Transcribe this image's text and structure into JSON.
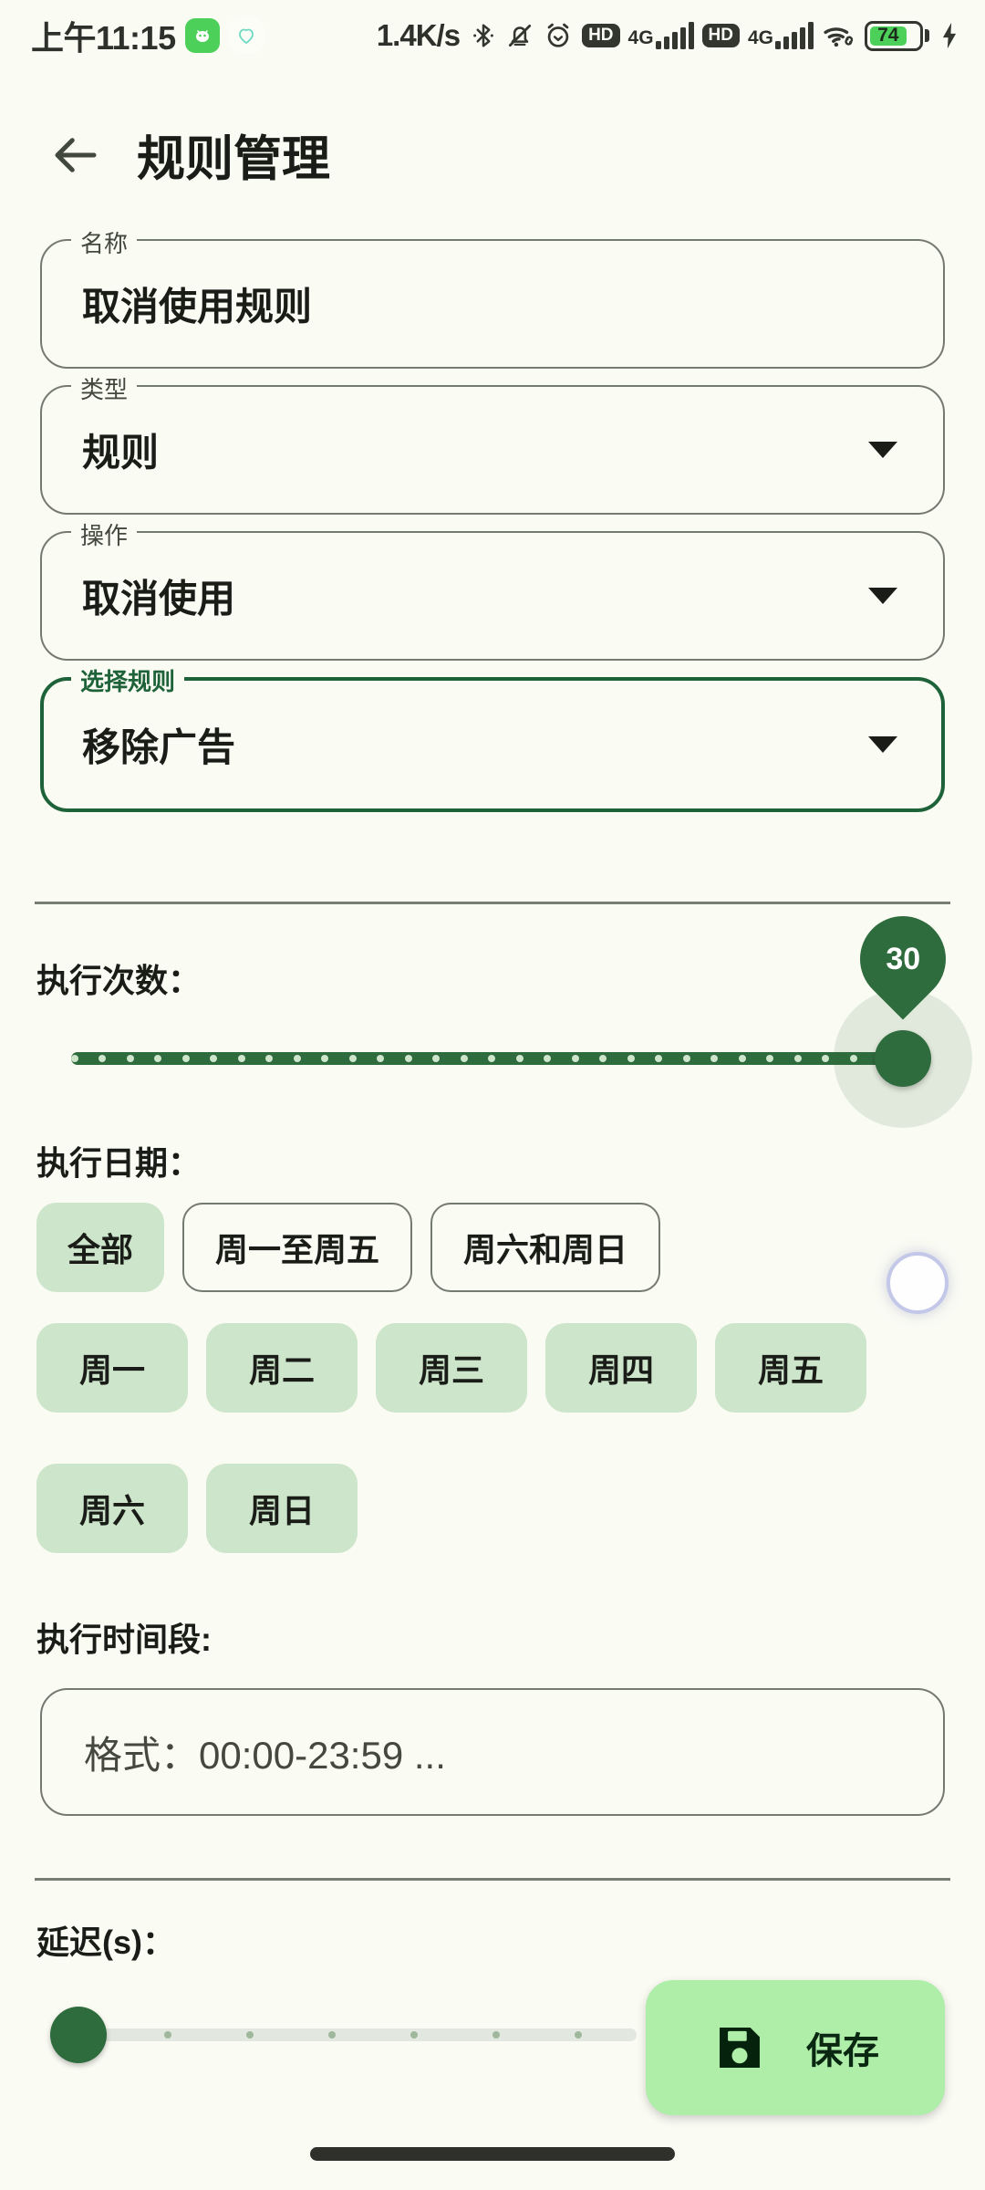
{
  "status_bar": {
    "time": "上午11:15",
    "network_speed": "1.4K/s",
    "icons": [
      "android-app-icon",
      "heart-app-icon",
      "bluetooth-icon",
      "mute-bell-icon",
      "alarm-icon",
      "hd-icon",
      "signal-bars-icon",
      "4g-icon",
      "wifi-icon",
      "battery-icon",
      "charging-bolt-icon"
    ],
    "hd_label": "HD",
    "net_label_1": "4G",
    "net_label_2": "4G",
    "battery_level": "74"
  },
  "app_bar": {
    "back_icon": "arrow-left-icon",
    "title": "规则管理"
  },
  "form": {
    "fields": [
      {
        "legend": "名称",
        "value": "取消使用规则",
        "type": "text",
        "focused": false
      },
      {
        "legend": "类型",
        "value": "规则",
        "type": "select",
        "focused": false
      },
      {
        "legend": "操作",
        "value": "取消使用",
        "type": "select",
        "focused": false
      },
      {
        "legend": "选择规则",
        "value": "移除广告",
        "type": "select",
        "focused": true
      }
    ]
  },
  "execution_count": {
    "label": "执行次数：",
    "value": "30",
    "min": 0,
    "max": 30,
    "percent": 100
  },
  "execution_days": {
    "label": "执行日期：",
    "presets": [
      {
        "label": "全部",
        "selected": true
      },
      {
        "label": "周一至周五",
        "selected": false
      },
      {
        "label": "周六和周日",
        "selected": false
      }
    ],
    "days_row1": [
      {
        "label": "周一",
        "selected": true
      },
      {
        "label": "周二",
        "selected": true
      },
      {
        "label": "周三",
        "selected": true
      },
      {
        "label": "周四",
        "selected": true
      },
      {
        "label": "周五",
        "selected": true
      }
    ],
    "days_row2": [
      {
        "label": "周六",
        "selected": true
      },
      {
        "label": "周日",
        "selected": true
      }
    ]
  },
  "execution_time_range": {
    "label": "执行时间段:",
    "placeholder": "格式：00:00-23:59 ...",
    "value": ""
  },
  "delay": {
    "label": "延迟(s)：",
    "value": "0",
    "min": 0,
    "max": 6,
    "percent": 0
  },
  "save_button": {
    "label": "保存",
    "icon": "save-floppy-icon"
  },
  "floating_ball": {
    "icon": "assistive-touch-ball"
  },
  "colors": {
    "background": "#FAFBF3",
    "primary_green": "#2E6B3D",
    "focus_green": "#1D6238",
    "chip_selected": "#CDE5CB",
    "fab_green": "#AEEEA8",
    "outline": "#757A71",
    "text": "#1A1C18",
    "battery_green": "#4CD05A"
  }
}
